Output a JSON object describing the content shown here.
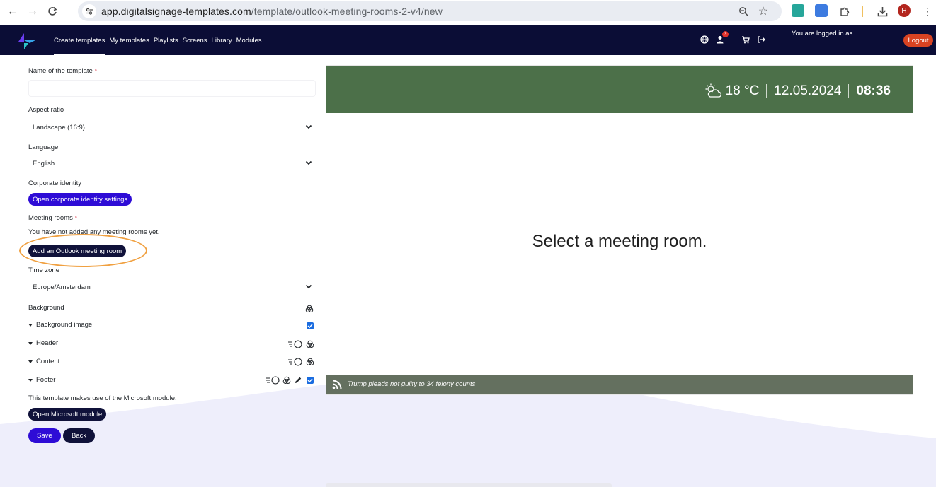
{
  "browser": {
    "url_host": "app.digitalsignage-templates.com",
    "url_path": "/template/outlook-meeting-rooms-2-v4/new",
    "profile_initial": "H",
    "icons": [
      "back-arrow-icon",
      "forward-arrow-icon",
      "reload-icon",
      "site-settings-icon",
      "zoom-icon",
      "star-icon",
      "extension-icon",
      "puzzle-icon",
      "download-icon",
      "more-menu-icon"
    ]
  },
  "navbar": {
    "links": [
      "Create templates",
      "My templates",
      "Playlists",
      "Screens",
      "Library",
      "Modules"
    ],
    "active_link": "Create templates",
    "cart_count": "3",
    "logged_in_label": "You are logged in as",
    "logout_label": "Logout"
  },
  "form": {
    "name_label": "Name of the template",
    "required_mark": "*",
    "name_value": "",
    "aspect_label": "Aspect ratio",
    "aspect_value": "Landscape (16:9)",
    "language_label": "Language",
    "language_value": "English",
    "corporate_label": "Corporate identity",
    "corporate_button": "Open corporate identity settings",
    "rooms_label": "Meeting rooms",
    "rooms_empty": "You have not added any meeting rooms yet.",
    "add_room_button": "Add an Outlook meeting room",
    "timezone_label": "Time zone",
    "timezone_value": "Europe/Amsterdam",
    "background_label": "Background",
    "bg_image_label": "Background image",
    "header_label": "Header",
    "content_label": "Content",
    "footer_label": "Footer",
    "module_note": "This template makes use of the Microsoft module.",
    "module_button": "Open Microsoft module",
    "save_button": "Save",
    "back_button": "Back"
  },
  "preview": {
    "temperature": "18 °C",
    "date": "12.05.2024",
    "time": "08:36",
    "message": "Select a meeting room.",
    "ticker": "Trump pleads not guilty to 34 felony counts",
    "header_color": "#4c7049",
    "footer_color": "#64705f"
  },
  "colors": {
    "navbar": "#0b0d36",
    "primary_button": "#2e0cd6",
    "dark_button": "#10123a",
    "logout": "#d84322",
    "highlight_ring": "#f0a040"
  }
}
